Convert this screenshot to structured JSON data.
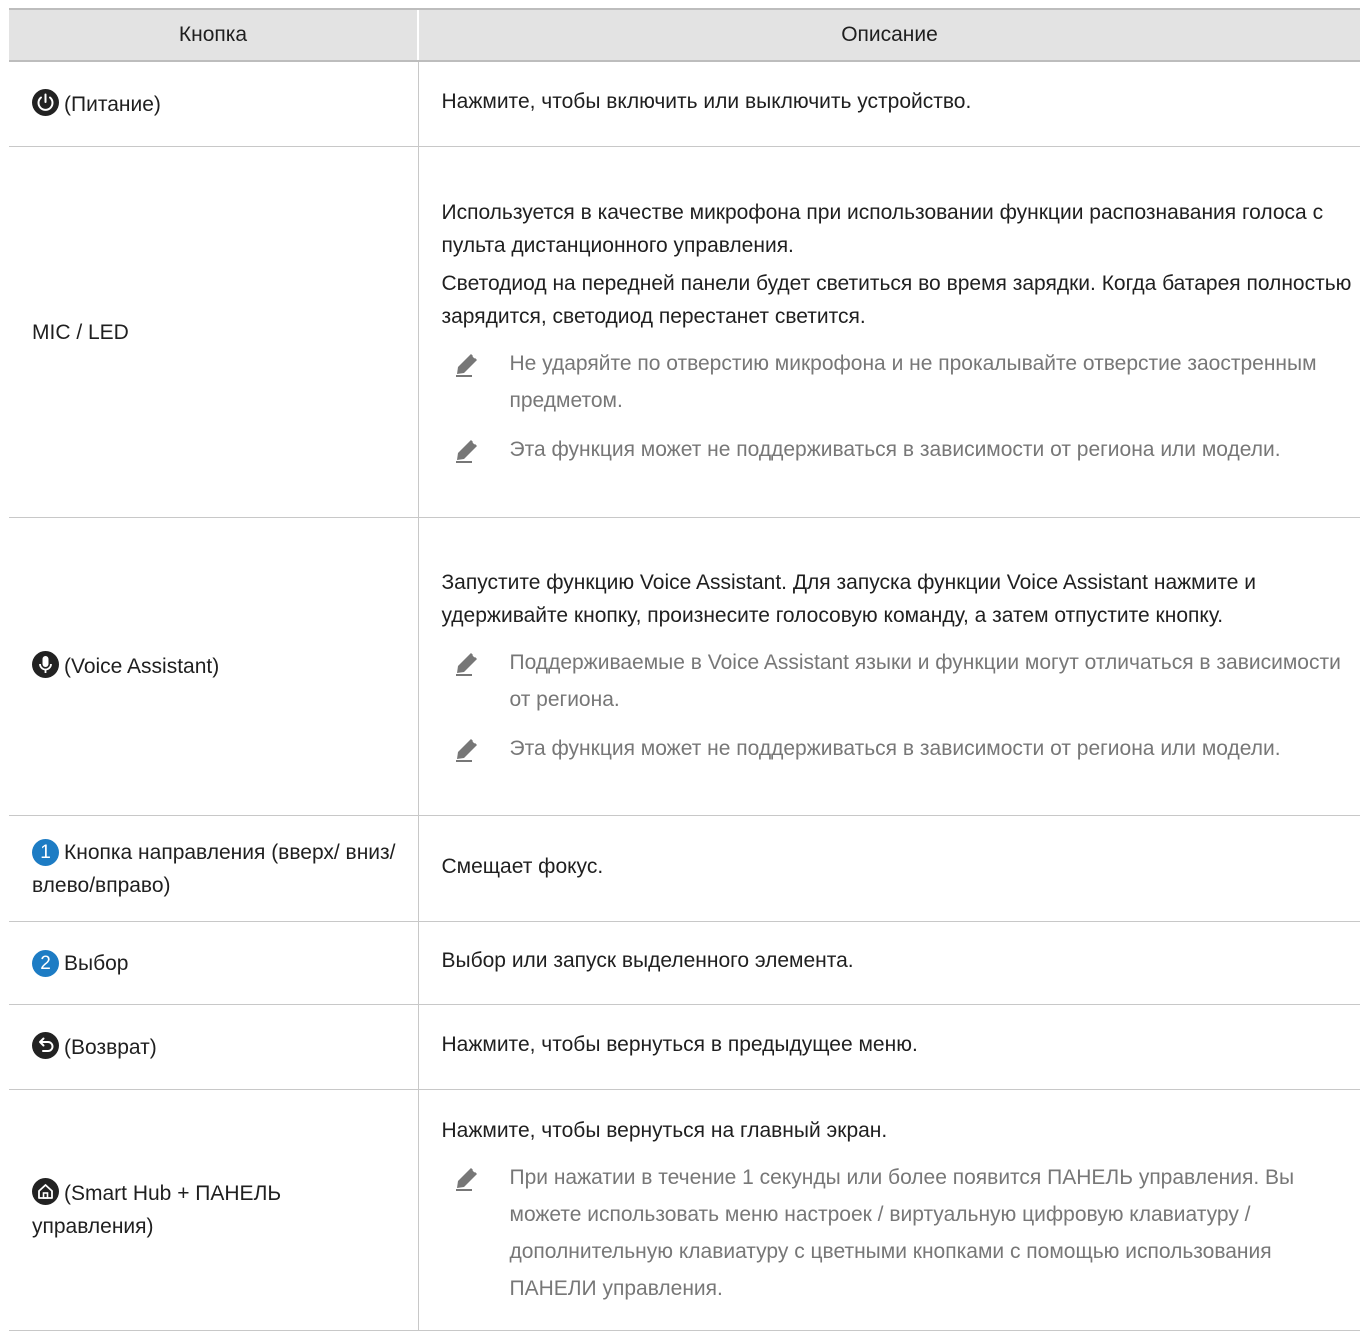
{
  "header": {
    "col_button": "Кнопка",
    "col_description": "Описание"
  },
  "rows": [
    {
      "icon": "power-icon",
      "key": "(Питание)",
      "text": [
        "Нажмите, чтобы включить или выключить устройство."
      ],
      "notes": []
    },
    {
      "icon": "",
      "key": "MIC / LED",
      "text": [
        "Используется в качестве микрофона при использовании функции распознавания голоса с пульта дистанционного управления.",
        "Светодиод на передней панели будет светиться во время зарядки. Когда батарея полностью зарядится, светодиод перестанет светится."
      ],
      "notes": [
        "Не ударяйте по отверстию микрофона и не прокалывайте отверстие заостренным предметом.",
        "Эта функция может не поддерживаться в зависимости от региона или модели."
      ]
    },
    {
      "icon": "microphone-icon",
      "key": "(Voice Assistant)",
      "text": [
        "Запустите функцию Voice Assistant. Для запуска функции Voice Assistant нажмите и удерживайте кнопку, произнесите голосовую команду, а затем отпустите кнопку."
      ],
      "notes": [
        "Поддерживаемые в Voice Assistant языки и функции могут отличаться в зависимости от региона.",
        "Эта функция может не поддерживаться в зависимости от региона или модели."
      ]
    },
    {
      "badge": "1",
      "key": "Кнопка направления (вверх/ вниз/влево/вправо)",
      "text": [
        "Смещает фокус."
      ],
      "notes": []
    },
    {
      "badge": "2",
      "key": "Выбор",
      "text": [
        "Выбор или запуск выделенного элемента."
      ],
      "notes": []
    },
    {
      "icon": "return-icon",
      "key": "(Возврат)",
      "text": [
        "Нажмите, чтобы вернуться в предыдущее меню."
      ],
      "notes": []
    },
    {
      "icon": "home-icon",
      "key": "(Smart Hub + ПАНЕЛЬ управления)",
      "text": [
        "Нажмите, чтобы вернуться на главный экран."
      ],
      "notes": [
        "При нажатии в течение 1 секунды или более появится ПАНЕЛЬ управления. Вы можете использовать меню настроек / виртуальную цифровую клавиатуру / дополнительную клавиатуру с цветными кнопками с помощью использования ПАНЕЛИ управления."
      ]
    }
  ],
  "colors": {
    "header_bg": "#e3e3e3",
    "badge": "#1d7cc4",
    "note_text": "#777777",
    "icon_bg": "#222222"
  }
}
